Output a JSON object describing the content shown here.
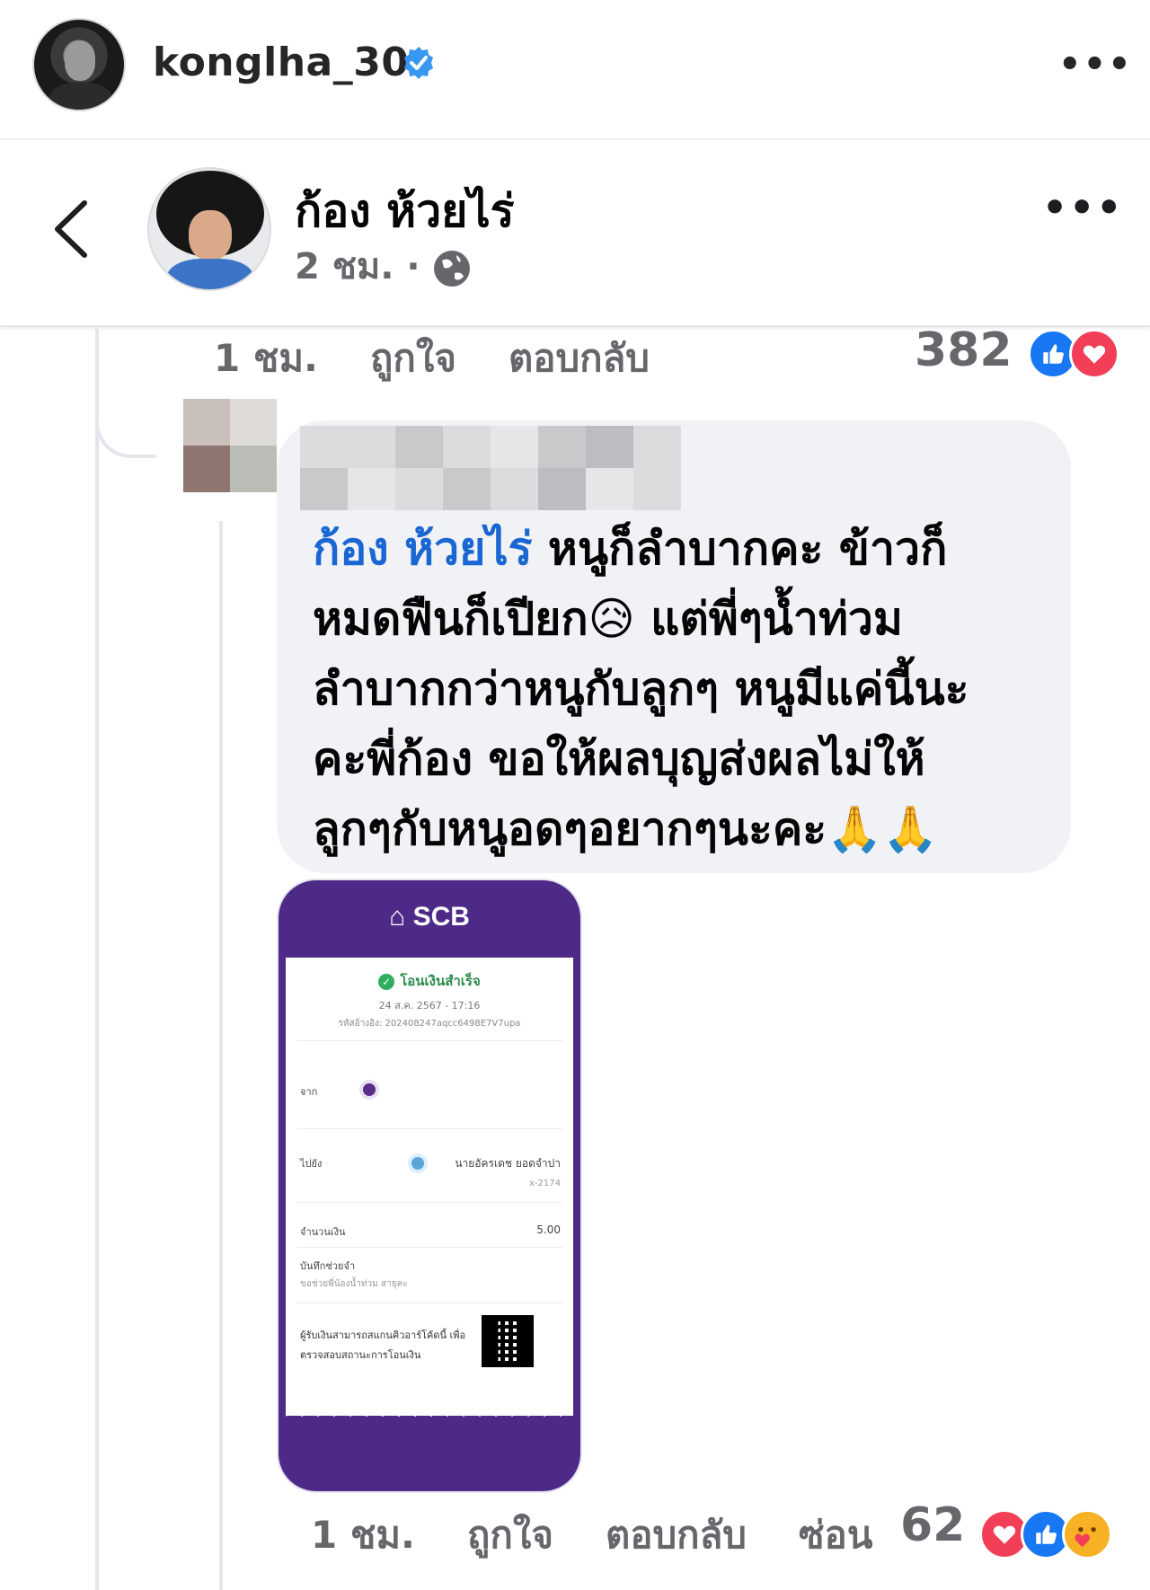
{
  "ig_header": {
    "username": "konglha_30",
    "more_label": "•••"
  },
  "fb_post": {
    "author_name": "ก้อง ห้วยไร่",
    "meta_time": "2 ชม. ·",
    "more_label": "•••"
  },
  "top_actions": {
    "time": "1 ชม.",
    "like": "ถูกใจ",
    "reply": "ตอบกลับ",
    "reaction_count": "382",
    "reactions": [
      "like-icon",
      "love-icon"
    ]
  },
  "comment": {
    "mention": "ก้อง ห้วยไร่",
    "text": " หนูก็ลำบากคะ ข้าวก็\nหมดฟืนก็เปียก😥 แต่พี่ๆน้ำท่วม\nลำบากกว่าหนูกับลูกๆ หนูมีแค่นี้นะ\nคะพี่ก้อง ขอให้ผลบุญส่งผลไม่ให้\nลูกๆกับหนูอดๆอยากๆนะคะ🙏🙏"
  },
  "slip": {
    "bank": "SCB",
    "status": "โอนเงินสำเร็จ",
    "date": "24 ส.ค. 2567 - 17:16",
    "ref": "รหัสอ้างอิง: 202408247aqcc6498E7V7upa",
    "from_label": "จาก",
    "to_label": "ไปยัง",
    "to_name": "นายอัครเดช ยอดจำปา",
    "to_account": "x-2174",
    "amount_label": "จำนวนเงิน",
    "amount": "5.00",
    "note_label": "บันทึกช่วยจำ",
    "note": "ขอช่วยพี่น้องน้ำท่วม สาธุคะ",
    "qr_text": "ผู้รับเงินสามารถสแกนคิวอาร์โค้ดนี้ เพื่อตรวจสอบสถานะการโอนเงิน"
  },
  "bottom_actions": {
    "time": "1 ชม.",
    "like": "ถูกใจ",
    "reply": "ตอบกลับ",
    "hide": "ซ่อน",
    "reaction_count": "62",
    "reactions": [
      "love-icon",
      "like-icon",
      "care-icon"
    ]
  },
  "colors": {
    "mention_blue": "#1a66d2",
    "scb_purple": "#4d2a87",
    "bubble_bg": "#f0f2f5",
    "verified_blue": "#3897f0"
  }
}
